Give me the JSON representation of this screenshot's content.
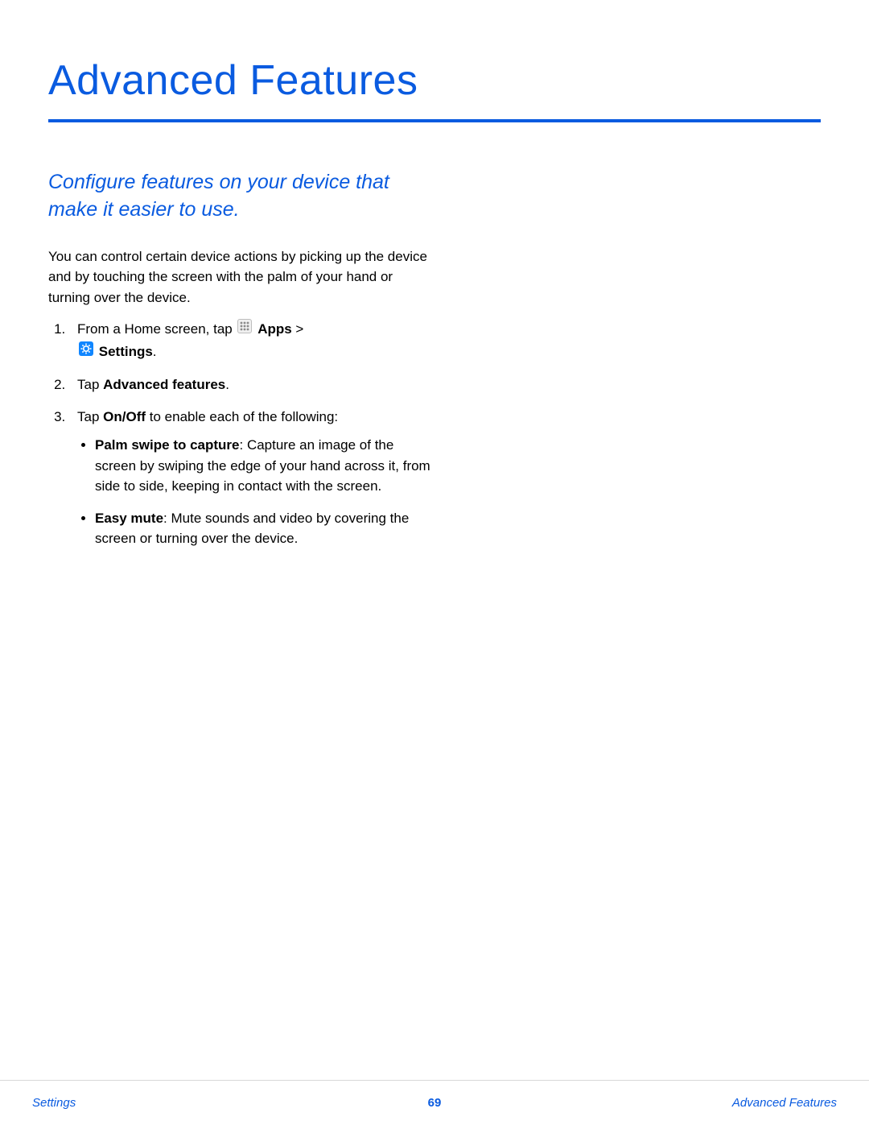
{
  "header": {
    "title": "Advanced Features"
  },
  "subtitle": "Configure features on your device that make it easier to use.",
  "intro": "You can control certain device actions by picking up the device and by touching the screen with the palm of your hand or turning over the device.",
  "steps": {
    "s1_prefix": "From a Home screen, tap ",
    "s1_apps": "Apps",
    "s1_gt": " > ",
    "s1_settings": "Settings",
    "s1_period": ".",
    "s2_prefix": "Tap ",
    "s2_bold": "Advanced features",
    "s2_period": ".",
    "s3_prefix": "Tap ",
    "s3_bold": "On/Off",
    "s3_suffix": " to enable each of the following:"
  },
  "bullets": {
    "b1_bold": "Palm swipe to capture",
    "b1_rest": ": Capture an image of the screen by swiping the edge of your hand across it, from side to side, keeping in contact with the screen.",
    "b2_bold": "Easy mute",
    "b2_rest": ": Mute sounds and video by covering the screen or turning over the device."
  },
  "footer": {
    "left": "Settings",
    "center": "69",
    "right": "Advanced Features"
  },
  "icons": {
    "apps": "apps-icon",
    "settings": "settings-icon"
  }
}
